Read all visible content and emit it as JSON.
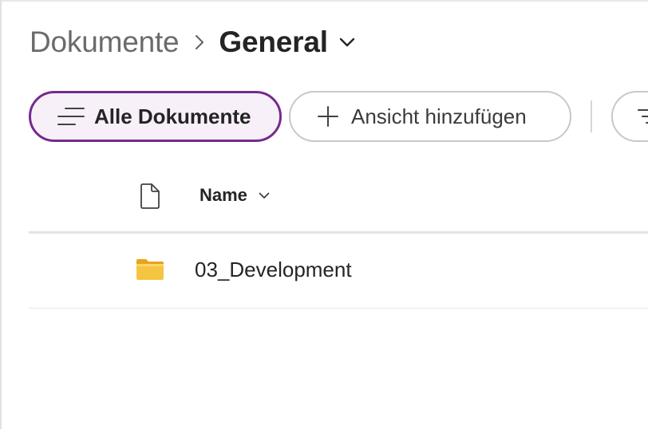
{
  "breadcrumb": {
    "root": "Dokumente",
    "current": "General"
  },
  "views": {
    "active_label": "Alle Dokumente",
    "add_label": "Ansicht hinzufügen"
  },
  "table": {
    "columns": {
      "name": "Name"
    },
    "rows": [
      {
        "name": "03_Development",
        "type": "folder"
      }
    ]
  },
  "icons": {
    "breadcrumb_separator": "chevron-right-icon",
    "breadcrumb_dropdown": "chevron-down-icon",
    "view_list": "list-lines-icon",
    "add_view": "plus-icon",
    "filter": "filter-icon",
    "file_type": "document-icon",
    "sort": "chevron-down-icon",
    "folder": "folder-icon"
  },
  "colors": {
    "accent": "#742a8c",
    "active_pill_bg": "#f7f0f9",
    "folder": "#f2c94c",
    "muted_text": "#6b6b6b"
  }
}
